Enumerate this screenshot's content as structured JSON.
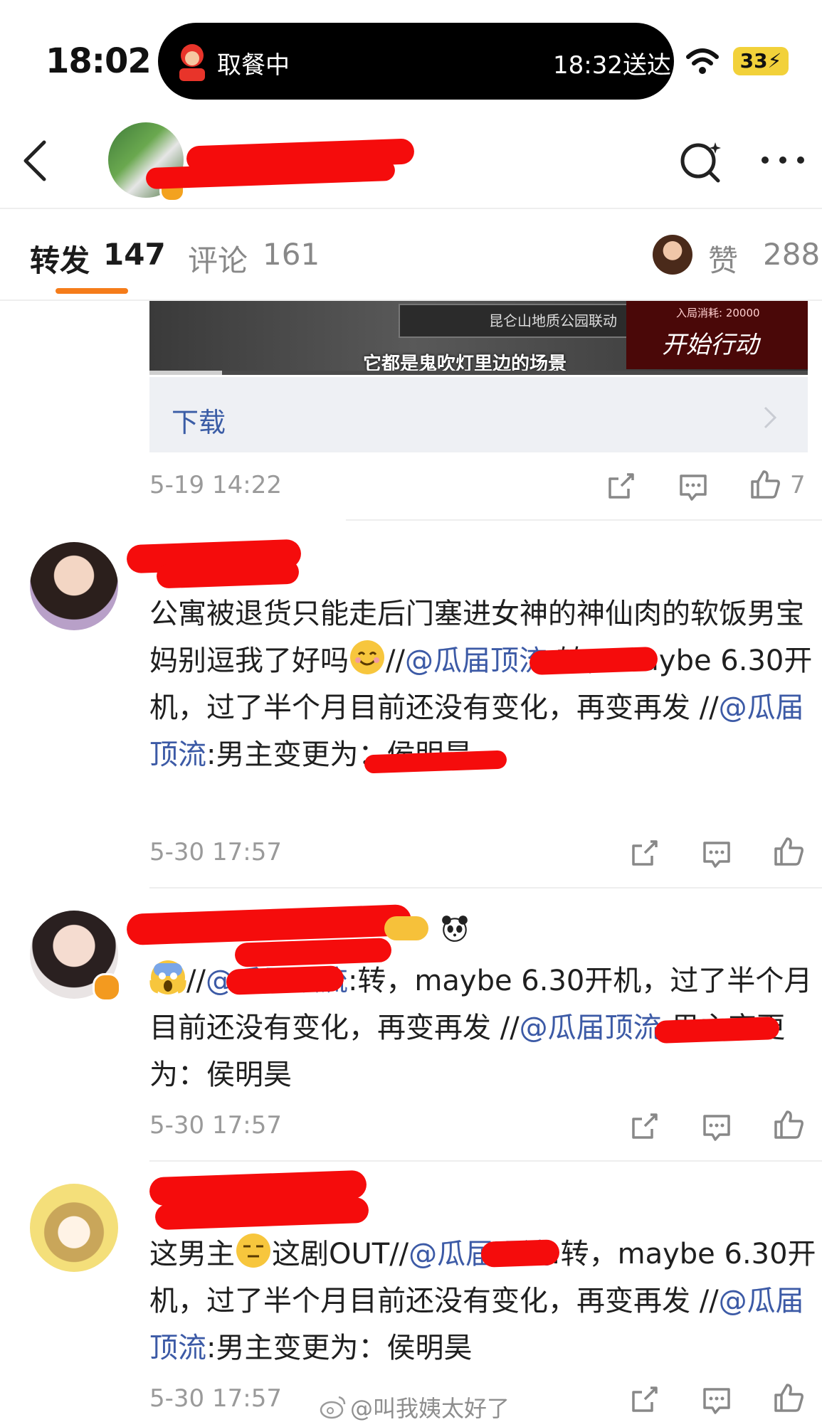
{
  "status_bar": {
    "time": "18:02",
    "activity_left": "取餐中",
    "activity_right": "18:32送达",
    "battery": "33"
  },
  "tabs": {
    "forward_label": "转发",
    "forward_count": "147",
    "comment_label": "评论",
    "comment_count": "161",
    "likes_label": "赞",
    "likes_count": "288"
  },
  "video": {
    "sign_text": "昆仑山地质公园联动",
    "banner_cost": "入局消耗: 20000",
    "banner_text": "开始行动",
    "subtitle": "它都是鬼吹灯里边的场景",
    "progress": 0.11
  },
  "download": {
    "label": "下载"
  },
  "post_meta": {
    "time": "5-19 14:22",
    "like_count": "7"
  },
  "reposts": [
    {
      "text_parts": [
        "公寓被退货只能走后门塞进女神的神仙肉的软饭男宝妈别逗我了好吗",
        "//",
        "@瓜届顶流",
        ":转，maybe 6.30开机，过了半个月目前还没有变化，再变再发 //",
        "@瓜届顶流",
        ":男主变更为：侯明昊"
      ],
      "time": "5-30 17:57"
    },
    {
      "text_parts": [
        "//",
        "@瓜届顶流",
        ":转，maybe 6.30开机，过了半个月目前还没有变化，再变再发 //",
        "@瓜届顶",
        "流",
        ":男主变更为：侯明昊"
      ],
      "time": "5-30 17:57"
    },
    {
      "text_parts": [
        "这男主",
        "这剧OUT//",
        "@瓜届顶流",
        ":转，maybe 6.30开机，过了半个月目前还没有变化，再变再发 //",
        "@瓜届顶流",
        ":男主变更为：侯明昊"
      ],
      "time": "5-30 17:57"
    }
  ],
  "watermark": "@叫我姨太好了",
  "colors": {
    "accent": "#f57c1a",
    "link": "#3c5aa6",
    "redaction": "#f50c0c"
  }
}
